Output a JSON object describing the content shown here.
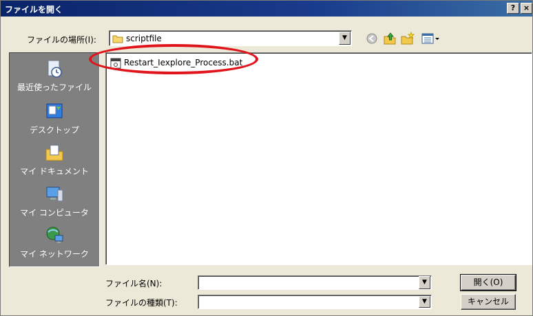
{
  "window": {
    "title": "ファイルを開く",
    "help": "?",
    "close": "×"
  },
  "lookin": {
    "label": "ファイルの場所(I):",
    "value": "scriptfile"
  },
  "places": [
    {
      "label": "最近使ったファイル",
      "icon": "recent-documents-icon"
    },
    {
      "label": "デスクトップ",
      "icon": "desktop-icon"
    },
    {
      "label": "マイ ドキュメント",
      "icon": "my-documents-icon"
    },
    {
      "label": "マイ コンピュータ",
      "icon": "my-computer-icon"
    },
    {
      "label": "マイ ネットワーク",
      "icon": "my-network-icon"
    }
  ],
  "files": [
    {
      "name": "Restart_Iexplore_Process.bat",
      "icon": "batch-file-icon"
    }
  ],
  "filename": {
    "label": "ファイル名(N):",
    "value": ""
  },
  "filetype": {
    "label": "ファイルの種類(T):",
    "value": ""
  },
  "buttons": {
    "open": "開く(O)",
    "cancel": "キャンセル"
  },
  "colors": {
    "titlebar": "#0a246a",
    "places_bg": "#808080",
    "highlight": "#e0141b",
    "face": "#ece9d8"
  }
}
